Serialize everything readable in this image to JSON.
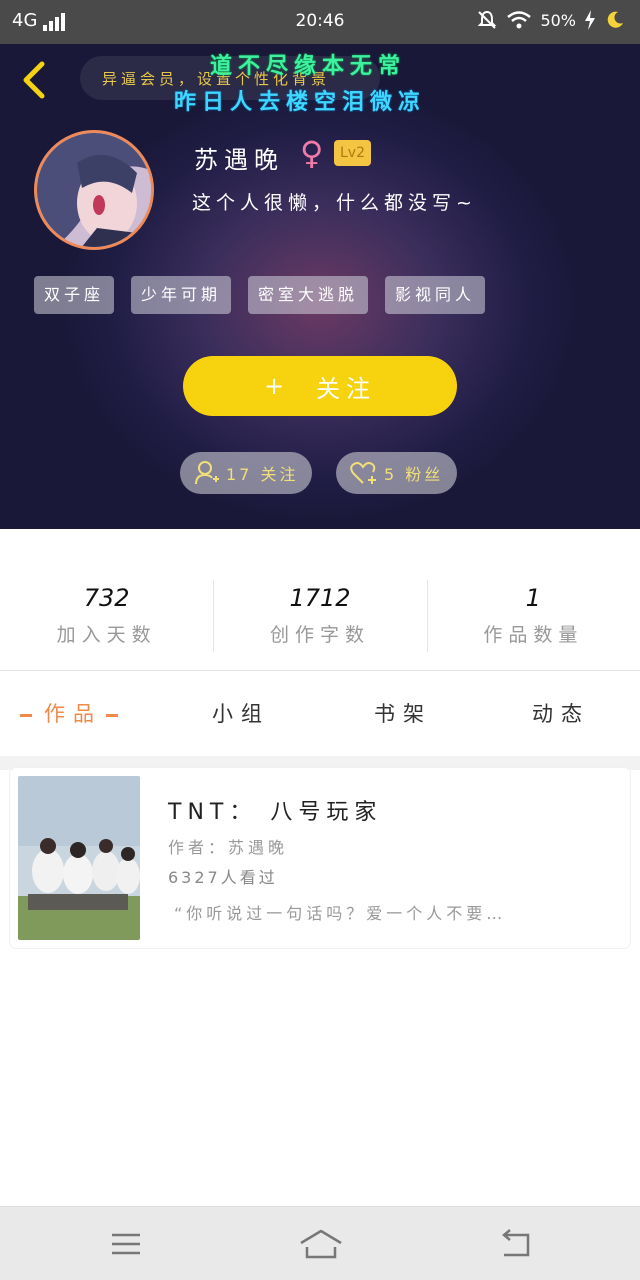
{
  "status_bar": {
    "network": "4G",
    "time": "20:46",
    "battery": "50%"
  },
  "header": {
    "notice": "异逼会员，设置个性化背景",
    "poem_line1": "道不尽缘本无常",
    "poem_line2": "昨日人去楼空泪微凉"
  },
  "profile": {
    "name": "苏遇晚",
    "gender_symbol": "♀",
    "level": "Lv2",
    "bio": "这个人很懒，什么都没写~",
    "tags": [
      "双子座",
      "少年可期",
      "密室大逃脱",
      "影视同人"
    ],
    "follow_label": "关注",
    "follow_plus": "+",
    "following_text": "17 关注",
    "fans_text": "5 粉丝"
  },
  "stats": [
    {
      "value": "732",
      "label": "加入天数"
    },
    {
      "value": "1712",
      "label": "创作字数"
    },
    {
      "value": "1",
      "label": "作品数量"
    }
  ],
  "tabs": [
    "作品",
    "小组",
    "书架",
    "动态"
  ],
  "active_tab": "作品",
  "work": {
    "title": "TNT：  八号玩家",
    "author": "作者：苏遇晚",
    "views": "6327人看过",
    "excerpt": "“你听说过一句话吗？爱一个人不要…"
  },
  "colors": {
    "accent": "#f6d20f",
    "tab_active": "#f08a4a",
    "poem1": "#3ef0a0",
    "poem2": "#3fd6ff",
    "avatar_border": "#ee8a5a"
  }
}
